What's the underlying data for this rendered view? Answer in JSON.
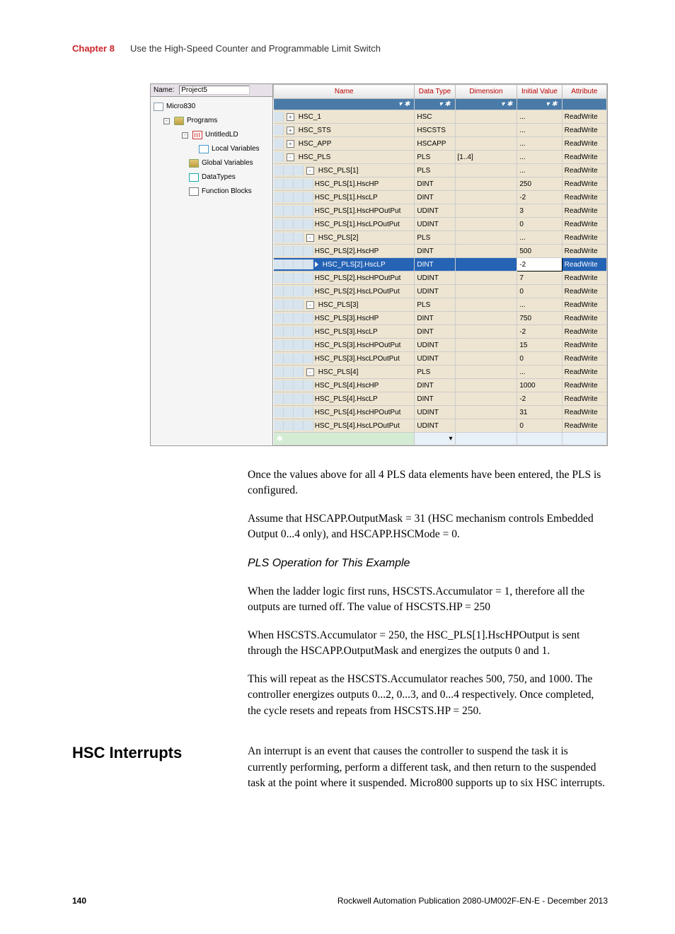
{
  "header": {
    "chapter": "Chapter 8",
    "title": "Use the High-Speed Counter and Programmable Limit Switch"
  },
  "screenshot": {
    "left": {
      "name_label": "Name:",
      "name_value": "Project5",
      "tree": {
        "root": "Micro830",
        "programs": "Programs",
        "untitled": "UntitledLD",
        "localvars": "Local Variables",
        "globalvars": "Global Variables",
        "datatypes": "DataTypes",
        "fblocks": "Function Blocks"
      }
    },
    "right": {
      "cols": {
        "name": "Name",
        "dt": "Data Type",
        "dim": "Dimension",
        "iv": "Initial Value",
        "attr": "Attribute"
      },
      "filter_glyph": "▾ ✱",
      "rows": [
        {
          "lvl": 0,
          "exp": "+",
          "name": "HSC_1",
          "dt": "HSC",
          "dim": "",
          "iv": "...",
          "attr": "ReadWrite"
        },
        {
          "lvl": 0,
          "exp": "+",
          "name": "HSC_STS",
          "dt": "HSCSTS",
          "dim": "",
          "iv": "...",
          "attr": "ReadWrite",
          "alt": true
        },
        {
          "lvl": 0,
          "exp": "+",
          "name": "HSC_APP",
          "dt": "HSCAPP",
          "dim": "",
          "iv": "...",
          "attr": "ReadWrite"
        },
        {
          "lvl": 0,
          "exp": "-",
          "name": "HSC_PLS",
          "dt": "PLS",
          "dim": "[1..4]",
          "iv": "...",
          "attr": "ReadWrite",
          "alt": true
        },
        {
          "lvl": 1,
          "exp": "-",
          "name": "HSC_PLS[1]",
          "dt": "PLS",
          "dim": "",
          "iv": "...",
          "attr": "ReadWrite"
        },
        {
          "lvl": 2,
          "name": "HSC_PLS[1].HscHP",
          "dt": "DINT",
          "dim": "",
          "iv": "250",
          "attr": "ReadWrite",
          "alt": true
        },
        {
          "lvl": 2,
          "name": "HSC_PLS[1].HscLP",
          "dt": "DINT",
          "dim": "",
          "iv": "-2",
          "attr": "ReadWrite"
        },
        {
          "lvl": 2,
          "name": "HSC_PLS[1].HscHPOutPut",
          "dt": "UDINT",
          "dim": "",
          "iv": "3",
          "attr": "ReadWrite",
          "alt": true
        },
        {
          "lvl": 2,
          "name": "HSC_PLS[1].HscLPOutPut",
          "dt": "UDINT",
          "dim": "",
          "iv": "0",
          "attr": "ReadWrite"
        },
        {
          "lvl": 1,
          "exp": "-",
          "name": "HSC_PLS[2]",
          "dt": "PLS",
          "dim": "",
          "iv": "...",
          "attr": "ReadWrite",
          "alt": true
        },
        {
          "lvl": 2,
          "name": "HSC_PLS[2].HscHP",
          "dt": "DINT",
          "dim": "",
          "iv": "500",
          "attr": "ReadWrite"
        },
        {
          "lvl": 2,
          "name": "HSC_PLS[2].HscLP",
          "dt": "DINT",
          "dim": "",
          "iv": "-2",
          "attr": "ReadWrite",
          "sel": true
        },
        {
          "lvl": 2,
          "name": "HSC_PLS[2].HscHPOutPut",
          "dt": "UDINT",
          "dim": "",
          "iv": "7",
          "attr": "ReadWrite"
        },
        {
          "lvl": 2,
          "name": "HSC_PLS[2].HscLPOutPut",
          "dt": "UDINT",
          "dim": "",
          "iv": "0",
          "attr": "ReadWrite",
          "alt": true
        },
        {
          "lvl": 1,
          "exp": "-",
          "name": "HSC_PLS[3]",
          "dt": "PLS",
          "dim": "",
          "iv": "...",
          "attr": "ReadWrite"
        },
        {
          "lvl": 2,
          "name": "HSC_PLS[3].HscHP",
          "dt": "DINT",
          "dim": "",
          "iv": "750",
          "attr": "ReadWrite",
          "alt": true
        },
        {
          "lvl": 2,
          "name": "HSC_PLS[3].HscLP",
          "dt": "DINT",
          "dim": "",
          "iv": "-2",
          "attr": "ReadWrite"
        },
        {
          "lvl": 2,
          "name": "HSC_PLS[3].HscHPOutPut",
          "dt": "UDINT",
          "dim": "",
          "iv": "15",
          "attr": "ReadWrite",
          "alt": true
        },
        {
          "lvl": 2,
          "name": "HSC_PLS[3].HscLPOutPut",
          "dt": "UDINT",
          "dim": "",
          "iv": "0",
          "attr": "ReadWrite"
        },
        {
          "lvl": 1,
          "exp": "-",
          "name": "HSC_PLS[4]",
          "dt": "PLS",
          "dim": "",
          "iv": "...",
          "attr": "ReadWrite",
          "alt": true
        },
        {
          "lvl": 2,
          "name": "HSC_PLS[4].HscHP",
          "dt": "DINT",
          "dim": "",
          "iv": "1000",
          "attr": "ReadWrite"
        },
        {
          "lvl": 2,
          "name": "HSC_PLS[4].HscLP",
          "dt": "DINT",
          "dim": "",
          "iv": "-2",
          "attr": "ReadWrite",
          "alt": true
        },
        {
          "lvl": 2,
          "name": "HSC_PLS[4].HscHPOutPut",
          "dt": "UDINT",
          "dim": "",
          "iv": "31",
          "attr": "ReadWrite"
        },
        {
          "lvl": 2,
          "name": "HSC_PLS[4].HscLPOutPut",
          "dt": "UDINT",
          "dim": "",
          "iv": "0",
          "attr": "ReadWrite",
          "alt": true
        }
      ],
      "star": "✱"
    }
  },
  "body": {
    "p1": "Once the values above for all 4 PLS data elements have been entered, the PLS is configured.",
    "p2": "Assume that HSCAPP.OutputMask = 31 (HSC mechanism controls Embedded Output 0...4 only), and HSCAPP.HSCMode = 0.",
    "sub": "PLS Operation for This Example",
    "p3": "When the ladder logic first runs, HSCSTS.Accumulator = 1, therefore all the outputs are turned off. The value of HSCSTS.HP = 250",
    "p4": "When HSCSTS.Accumulator = 250, the HSC_PLS[1].HscHPOutput is sent through the HSCAPP.OutputMask and energizes the outputs 0 and 1.",
    "p5": "This will repeat as the HSCSTS.Accumulator reaches 500, 750, and 1000. The controller energizes outputs 0...2, 0...3, and 0...4 respectively. Once completed, the cycle resets and repeats from HSCSTS.HP = 250."
  },
  "section": {
    "h": "HSC Interrupts",
    "p": "An interrupt is an event that causes the controller to suspend the task it is currently performing, perform a different task, and then return to the suspended task at the point where it suspended. Micro800 supports up to six HSC interrupts."
  },
  "footer": {
    "page": "140",
    "pub": "Rockwell Automation Publication 2080-UM002F-EN-E - December 2013"
  }
}
